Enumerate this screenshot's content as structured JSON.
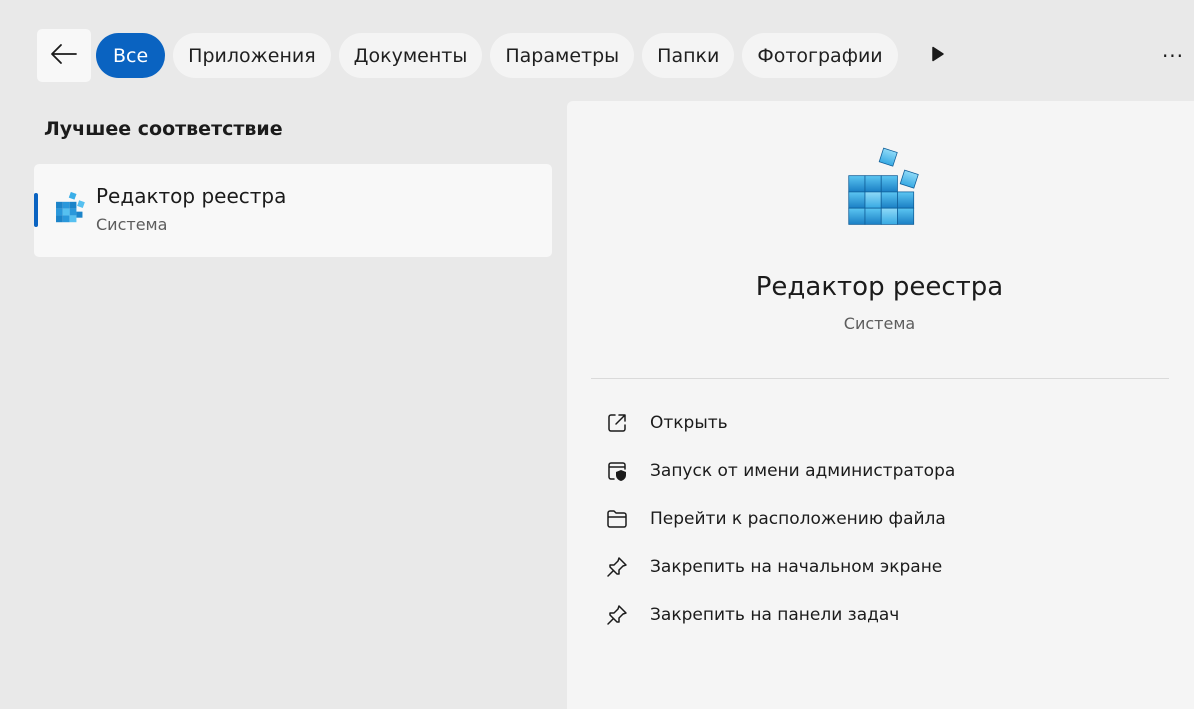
{
  "filters": {
    "back_icon": "arrow-left-icon",
    "chips": [
      {
        "id": "all",
        "label": "Все",
        "active": true
      },
      {
        "id": "apps",
        "label": "Приложения",
        "active": false
      },
      {
        "id": "documents",
        "label": "Документы",
        "active": false
      },
      {
        "id": "settings",
        "label": "Параметры",
        "active": false
      },
      {
        "id": "folders",
        "label": "Папки",
        "active": false
      },
      {
        "id": "photos",
        "label": "Фотографии",
        "active": false
      }
    ],
    "more_icon": "play-icon",
    "overflow_label": "···"
  },
  "results": {
    "section_title": "Лучшее соответствие",
    "best_match": {
      "title": "Редактор реестра",
      "subtitle": "Система",
      "icon": "registry-editor-icon"
    }
  },
  "detail": {
    "title": "Редактор реестра",
    "subtitle": "Система",
    "icon": "registry-editor-icon",
    "actions": [
      {
        "id": "open",
        "label": "Открыть",
        "icon": "open-external-icon"
      },
      {
        "id": "run-as-admin",
        "label": "Запуск от имени администратора",
        "icon": "shield-window-icon"
      },
      {
        "id": "open-location",
        "label": "Перейти к расположению файла",
        "icon": "folder-icon"
      },
      {
        "id": "pin-start",
        "label": "Закрепить на начальном экране",
        "icon": "pin-icon"
      },
      {
        "id": "pin-taskbar",
        "label": "Закрепить на панели задач",
        "icon": "pin-icon"
      }
    ]
  },
  "colors": {
    "accent": "#0a63c1",
    "background": "#e9e9e9",
    "surface": "#f5f5f5",
    "text": "#1b1b1b",
    "secondary_text": "#5d5d5d"
  }
}
